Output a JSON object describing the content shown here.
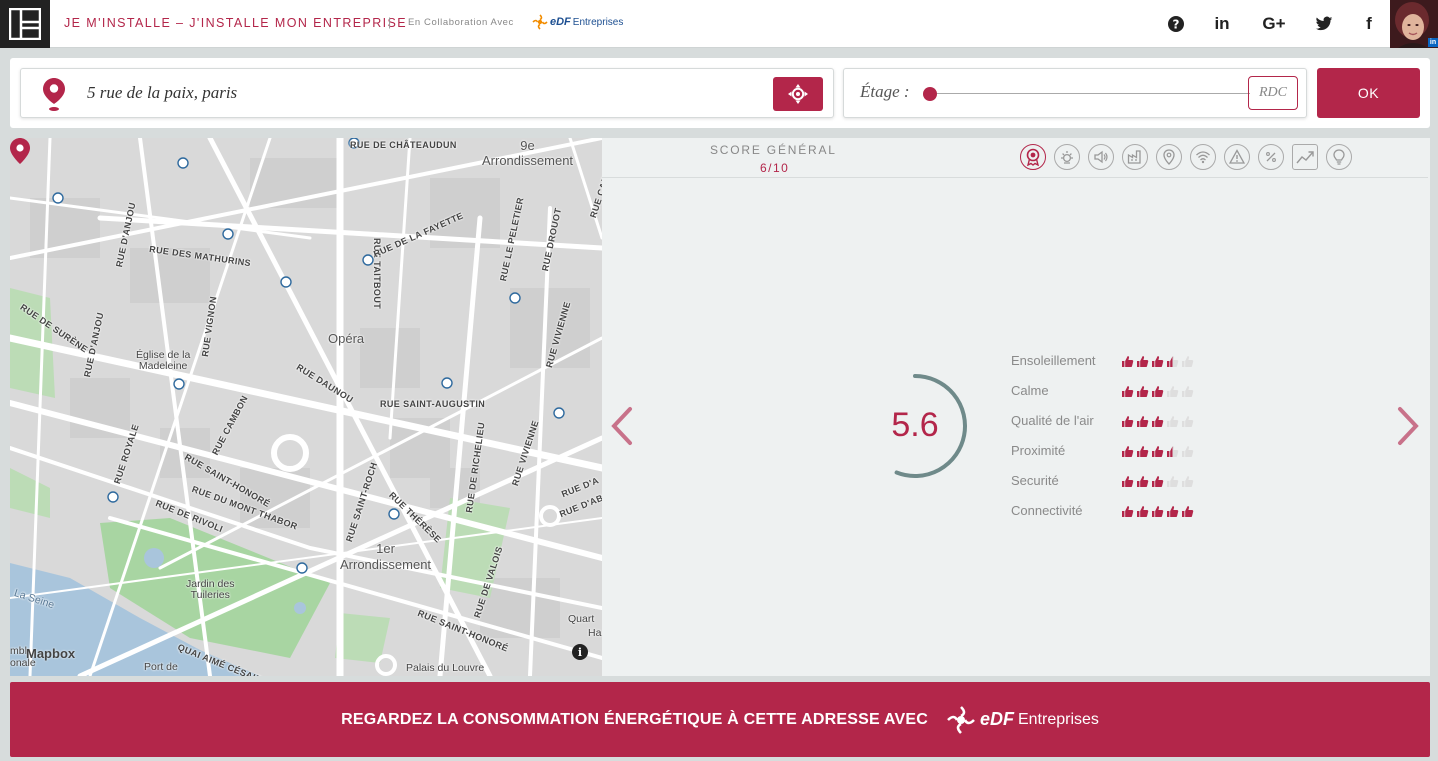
{
  "header": {
    "title": "JE M'INSTALLE – J'INSTALLE MON ENTREPRISE",
    "separator": "|",
    "collab_text": "En Collaboration Avec",
    "partner_word": "eDF",
    "partner_suffix": "Entreprises",
    "social": [
      {
        "icon": "help-icon",
        "glyph": "?"
      },
      {
        "icon": "linkedin-icon",
        "glyph": "in"
      },
      {
        "icon": "google-plus-icon",
        "glyph": "G+"
      },
      {
        "icon": "twitter-icon",
        "glyph": ""
      },
      {
        "icon": "facebook-icon",
        "glyph": "f"
      }
    ],
    "avatar_badge": "in"
  },
  "search": {
    "address_value": "5 rue de la paix, paris",
    "floor_label": "Étage :",
    "floor_value": "RDC",
    "ok_label": "OK"
  },
  "map": {
    "areas": {
      "top_arr": "9e\nArrondissement",
      "opera": "Opéra",
      "first_arr": "1er\nArrondissement",
      "jardin": "Jardin des\nTuileries",
      "madeleine": "Église de la\nMadeleine",
      "port": "Port de",
      "louvre": "Palais du Louvre",
      "seine": "La Seine",
      "quart": "Quart",
      "ha": "Ha",
      "left_edge_a": "mbl",
      "left_edge_b": "onale"
    },
    "streets": {
      "chateaudun": "RUE DE CHÂTEAUDUN",
      "taitbout": "RUE TAITBOUT",
      "fayette": "RUE DE LA FAYETTE",
      "peletier": "RUE LE PELETIER",
      "drouot": "RUE DROUOT",
      "cad": "RUE CADE",
      "anjou_top": "RUE D'ANJOU",
      "mathurins": "RUE DES MATHURINS",
      "suresne": "RUE DE SURÈNE",
      "anjou": "RUE D'ANJOU",
      "vignon": "RUE VIGNON",
      "daunou": "RUE DAUNOU",
      "augustin": "RUE SAINT-AUGUSTIN",
      "vivienne_top": "RUE VIVIENNE",
      "royale": "RUE ROYALE",
      "cambon": "RUE CAMBON",
      "sthonore": "RUE SAINT-HONORÉ",
      "montthabor": "RUE DU MONT THABOR",
      "rivoli": "RUE DE RIVOLI",
      "stroch": "RUE SAINT-ROCH",
      "therese": "RUE THÉRÈSE",
      "richelieu": "RUE DE RICHELIEU",
      "vivienne": "RUE VIVIENNE",
      "abo": "RUE D'ABO",
      "a": "RUE D'A",
      "valois": "RUE DE VALOIS",
      "sthonore2": "RUE SAINT-HONORÉ",
      "aimecesaire": "QUAI AIMÉ CÉSAIRE"
    },
    "attribution": "Mapbox",
    "info_glyph": "i"
  },
  "score": {
    "title": "SCORE GÉNÉRAL",
    "subtitle": "6/10",
    "value": "5.6",
    "value_fraction": 0.56,
    "tabs": [
      {
        "name": "award-icon",
        "active": true
      },
      {
        "name": "sun-icon",
        "active": false
      },
      {
        "name": "sound-icon",
        "active": false
      },
      {
        "name": "factory-icon",
        "active": false
      },
      {
        "name": "location-icon",
        "active": false
      },
      {
        "name": "wifi-icon",
        "active": false
      },
      {
        "name": "warning-icon",
        "active": false
      },
      {
        "name": "percent-icon",
        "active": false
      },
      {
        "name": "trend-icon",
        "active": false
      },
      {
        "name": "bulb-icon",
        "active": false
      }
    ],
    "criteria": [
      {
        "name": "Ensoleillement",
        "rating": 3.5
      },
      {
        "name": "Calme",
        "rating": 3
      },
      {
        "name": "Qualité de l'air",
        "rating": 3
      },
      {
        "name": "Proximité",
        "rating": 3.5
      },
      {
        "name": "Securité",
        "rating": 3
      },
      {
        "name": "Connectivité",
        "rating": 5
      }
    ],
    "rating_max": 5
  },
  "footer": {
    "cta": "REGARDEZ LA CONSOMMATION ÉNERGÉTIQUE À CETTE ADRESSE AVEC",
    "partner_word": "eDF",
    "partner_suffix": "Entreprises"
  },
  "colors": {
    "accent": "#b3264a",
    "gauge": "#6f8a8a",
    "thumb_empty": "#dedede"
  }
}
